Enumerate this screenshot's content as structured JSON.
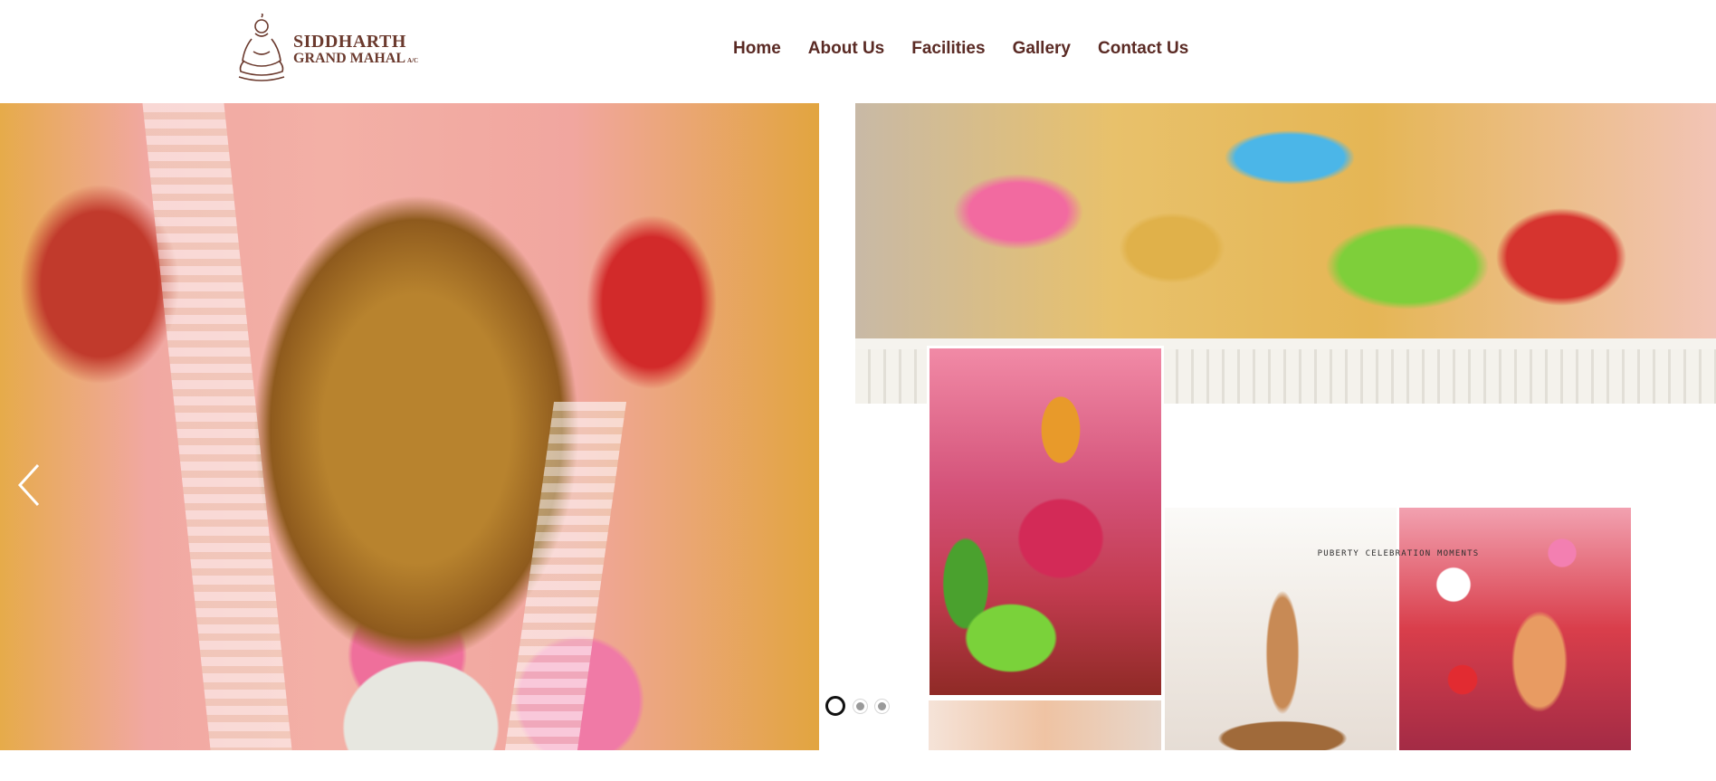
{
  "header": {
    "logo": {
      "line1": "SIDDHARTH",
      "line2": "GRAND MAHAL",
      "suffix": "A/C",
      "icon": "buddha-icon"
    },
    "nav": [
      {
        "label": "Home"
      },
      {
        "label": "About Us"
      },
      {
        "label": "Facilities"
      },
      {
        "label": "Gallery"
      },
      {
        "label": "Contact Us"
      }
    ]
  },
  "slider": {
    "caption": "PUBERTY CELEBRATION MOMENTS",
    "prev_icon": "chevron-left-icon",
    "next_icon": "chevron-right-icon",
    "slides_count": 3,
    "active_slide": 1
  },
  "colors": {
    "brand": "#6b3a2e",
    "nav_text": "#5a2a24",
    "active_dot": "#111111",
    "inactive_dot": "#9a9a9a"
  }
}
